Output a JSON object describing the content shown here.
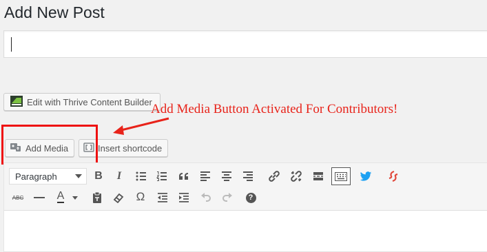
{
  "page": {
    "title": "Add New Post"
  },
  "title_field": {
    "value": "",
    "placeholder": ""
  },
  "buttons": {
    "thrive": "Edit with Thrive Content Builder",
    "add_media": "Add Media",
    "insert_shortcode": "Insert shortcode"
  },
  "annotation": {
    "text": "Add Media Button Activated For Contributors!",
    "color": "#e8231a"
  },
  "editor": {
    "format_select": "Paragraph",
    "toolbar_row1": [
      "bold-icon",
      "italic-icon",
      "bulleted-list-icon",
      "numbered-list-icon",
      "blockquote-icon",
      "align-left-icon",
      "align-center-icon",
      "align-right-icon",
      "insert-link-icon",
      "remove-link-icon",
      "read-more-icon",
      "toolbar-toggle-icon",
      "twitter-icon",
      "shortcode-icon"
    ],
    "toolbar_row2": [
      "strikethrough-icon",
      "horizontal-line-icon",
      "text-color-icon",
      "paste-as-text-icon",
      "clear-formatting-icon",
      "special-character-icon",
      "decrease-indent-icon",
      "increase-indent-icon",
      "undo-icon",
      "redo-icon",
      "help-icon"
    ],
    "bold_glyph": "B",
    "italic_glyph": "I",
    "text_color_glyph": "A",
    "omega_glyph": "Ω",
    "help_glyph": "?",
    "strike_glyph": "ABC"
  }
}
